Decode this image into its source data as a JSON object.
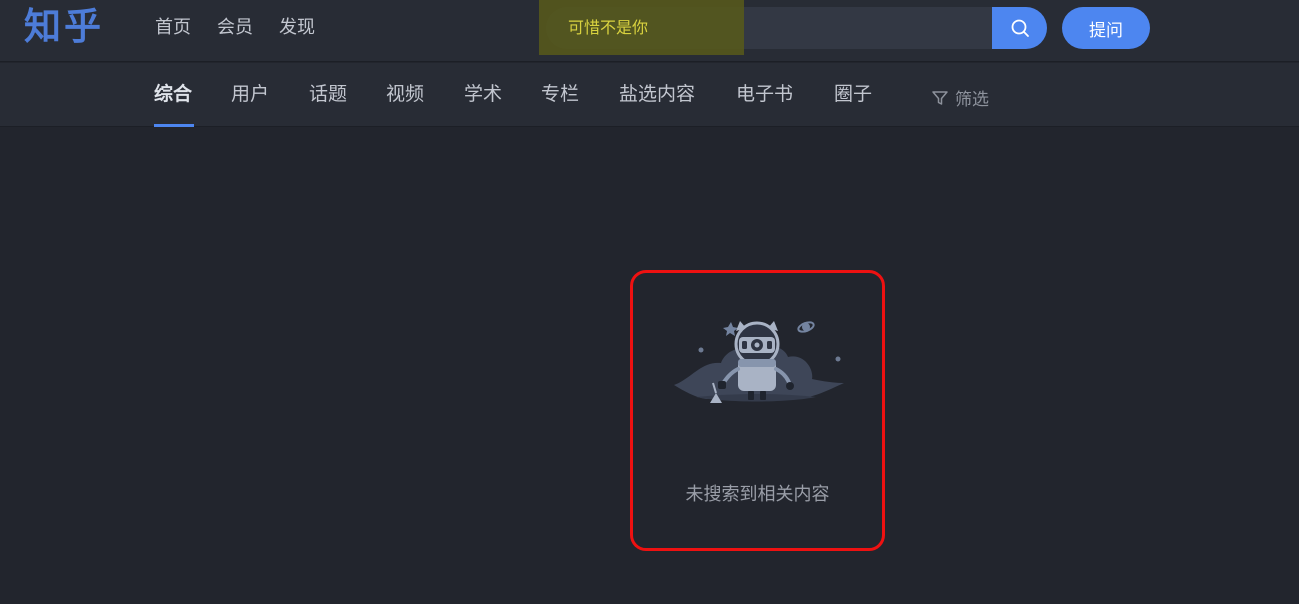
{
  "header": {
    "logo": "知乎",
    "nav": [
      "首页",
      "会员",
      "发现"
    ],
    "search_value": "可惜不是你",
    "search_icon": "search-icon",
    "ask_label": "提问"
  },
  "tabs": {
    "items": [
      "综合",
      "用户",
      "话题",
      "视频",
      "学术",
      "专栏",
      "盐选内容",
      "电子书",
      "圈子"
    ],
    "active": "综合",
    "filter_label": "筛选",
    "filter_icon": "filter-icon"
  },
  "empty_state": {
    "illustration": "robot-astronaut-illustration",
    "message": "未搜索到相关内容"
  },
  "colors": {
    "accent": "#4d86f0",
    "highlight_box": "#ee1111",
    "search_text": "#d9d23f"
  }
}
